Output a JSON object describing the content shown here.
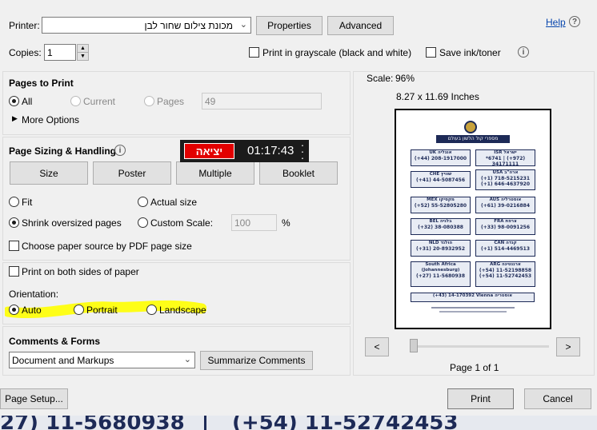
{
  "printer": {
    "label": "Printer:",
    "selected": "מכונת צילום שחור לבן",
    "properties_label": "Properties",
    "advanced_label": "Advanced",
    "help_label": "Help",
    "help_glyph": "?"
  },
  "copies": {
    "label": "Copies:",
    "value": "1",
    "grayscale_label": "Print in grayscale (black and white)",
    "save_ink_label": "Save ink/toner",
    "info_glyph": "i"
  },
  "pages_to_print": {
    "title": "Pages to Print",
    "all_label": "All",
    "current_label": "Current",
    "pages_label": "Pages",
    "pages_value": "49",
    "more_options_label": "More Options"
  },
  "sizing": {
    "title": "Page Sizing & Handling",
    "info_glyph": "i",
    "tabs": [
      "Size",
      "Poster",
      "Multiple",
      "Booklet"
    ],
    "fit_label": "Fit",
    "actual_size_label": "Actual size",
    "shrink_label": "Shrink oversized pages",
    "custom_scale_label": "Custom Scale:",
    "custom_scale_value": "100",
    "percent": "%",
    "paper_source_label": "Choose paper source by PDF page size"
  },
  "overlay": {
    "exit_label": "יציאה",
    "timer": "01:17:43"
  },
  "both_sides": {
    "label": "Print on both sides of paper"
  },
  "orientation": {
    "title": "Orientation:",
    "auto_label": "Auto",
    "portrait_label": "Portrait",
    "landscape_label": "Landscape",
    "highlight_color": "#ffff00"
  },
  "comments": {
    "title": "Comments & Forms",
    "selected": "Document and Markups",
    "summarize_label": "Summarize Comments"
  },
  "preview": {
    "scale_label": "Scale:",
    "scale_value": "96%",
    "paper_size": "8.27 x 11.69 Inches",
    "prev_glyph": "<",
    "next_glyph": ">",
    "page_indicator": "Page 1 of 1",
    "doc": {
      "header": "מספרי קול הלשון בעולם",
      "cards": [
        {
          "name": "UK  אנגליה",
          "num": "(+44) 208-1917000"
        },
        {
          "name": "ISR  ישראל",
          "num": "*6741 | (+972) 34171111"
        },
        {
          "name": "CHE  שוויץ",
          "num": "(+41) 44-5087456"
        },
        {
          "name": "USA  ארה\"ב",
          "num": "(+1) 718-5215231"
        },
        {
          "name": "MEX  מקסיקו",
          "num": "(+52) 55-52805280"
        },
        {
          "name": "AUS  אוסטרליה",
          "num": "(+61) 39-0216884"
        },
        {
          "name": "BEL  בלגיה",
          "num": "(+32) 38-080388"
        },
        {
          "name": "FRA  צרפת",
          "num": "(+33) 98-0091256"
        },
        {
          "name": "NLD  הולנד",
          "num": "(+31) 20-8932952"
        },
        {
          "name": "CAN  קנדה",
          "num": "(+1) 514-4469513"
        },
        {
          "name": "South Africa (Johannesburg)",
          "num": "(+27) 11-5680938"
        },
        {
          "name": "ARG  ארגנטינה",
          "num": "(+54) 11-52198858"
        }
      ],
      "extra_usa": "(+1) 646-4637920",
      "extra_arg": "(+54) 11-52742453",
      "bottom": "(+43) 14-170392   Vienna   אוסטריה"
    }
  },
  "footer": {
    "page_setup_label": "Page Setup...",
    "print_label": "Print",
    "cancel_label": "Cancel"
  },
  "background_text": {
    "left": "27) 11-5680938",
    "right": "(+54) 11-52742453"
  }
}
